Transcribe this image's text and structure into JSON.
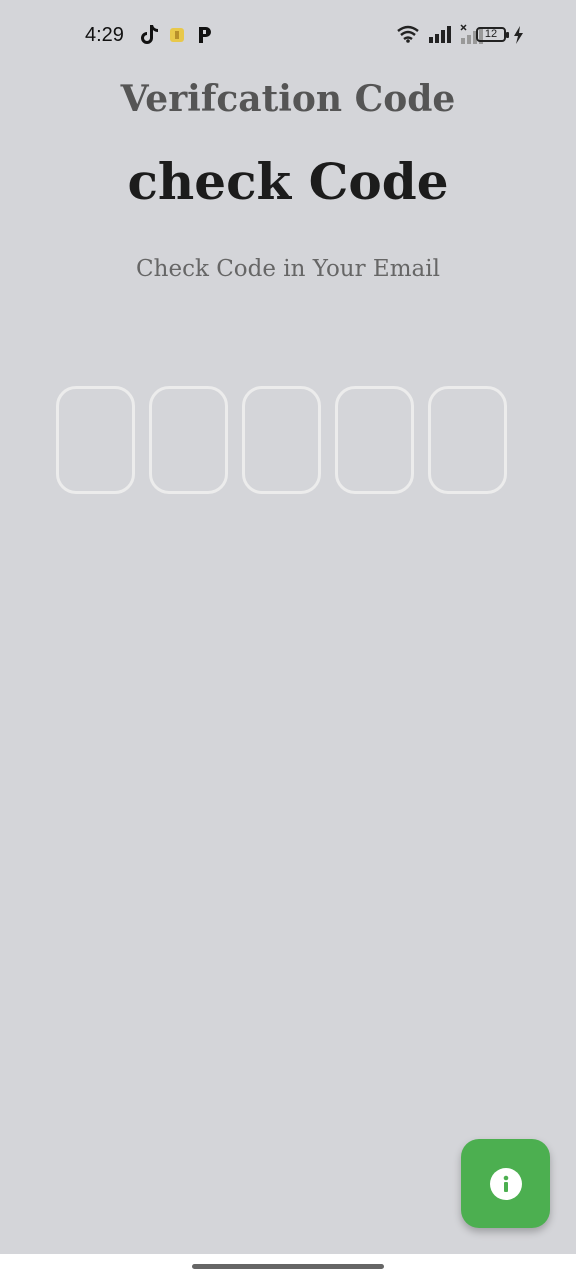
{
  "status_bar": {
    "time": "4:29",
    "battery_level": "12",
    "icons": [
      "tiktok-icon",
      "notification-app-icon",
      "parking-app-icon",
      "wifi-icon",
      "signal-icon",
      "signal-no-service-icon",
      "battery-icon",
      "charging-icon"
    ]
  },
  "header": {
    "title_top": "Verifcation Code",
    "title_main": "check Code",
    "subtitle": "Check Code in Your Email"
  },
  "code_input": {
    "boxes": [
      "",
      "",
      "",
      "",
      ""
    ]
  },
  "fab": {
    "icon": "info-icon",
    "color": "#4caf50"
  },
  "colors": {
    "background": "#d4d5d9",
    "box_border": "#ececec"
  }
}
